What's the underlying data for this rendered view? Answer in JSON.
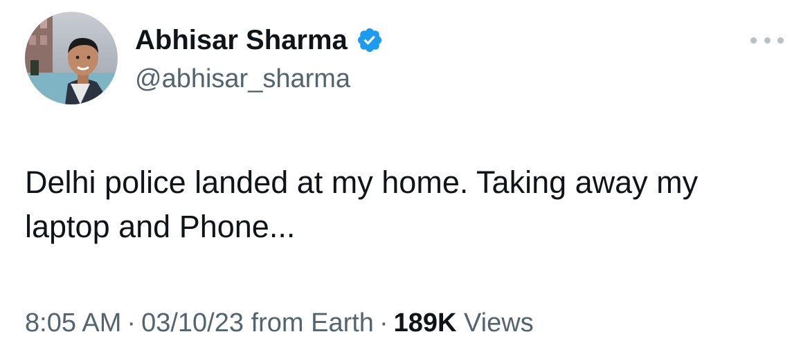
{
  "author": {
    "display_name": "Abhisar Sharma",
    "handle": "@abhisar_sharma",
    "verified_icon": "verified-badge-icon",
    "verified_color": "#1d9bf0"
  },
  "tweet": {
    "text": "Delhi police landed at my home. Taking away my laptop and Phone..."
  },
  "meta": {
    "time": "8:05 AM",
    "separator": "·",
    "date": "03/10/23",
    "source": "from Earth",
    "views_count": "189K",
    "views_label": "Views"
  },
  "actions": {
    "more_icon": "more-horizontal-icon"
  },
  "colors": {
    "text_primary": "#0f1419",
    "text_secondary": "#536471",
    "background": "#ffffff"
  }
}
